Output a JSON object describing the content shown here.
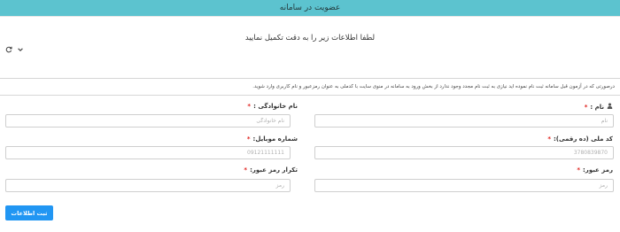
{
  "header": {
    "title": "عضویت در سامانه"
  },
  "instructions": "لطفا اطلاعات زیر را به دقت تکمیل نمایید",
  "toolbar": {
    "refresh_icon": "refresh-icon",
    "collapse_icon": "chevron-down-icon"
  },
  "notice": "درصورتی که در آزمون قبل سامانه ثبت نام نموده اید نیازی به ثبت نام مجدد وجود ندارد از بخش ورود به سامانه در منوی سایت با کدملی به عنوان رمزعبور و نام کاربری وارد شوید.",
  "form": {
    "required_mark": "*",
    "first_name": {
      "label": "نام :",
      "placeholder": "نام",
      "icon": "user-icon"
    },
    "last_name": {
      "label": "نام خانوادگی :",
      "placeholder": "نام خانوادگی"
    },
    "national_code": {
      "label": "کد ملی (ده رقمی):",
      "placeholder": "3780839870"
    },
    "mobile": {
      "label": "شماره موبایل:",
      "placeholder": "09121111111"
    },
    "password": {
      "label": "رمز عبور:",
      "placeholder": "رمز"
    },
    "password_repeat": {
      "label": "تکرار رمز عبور:",
      "placeholder": "رمز"
    },
    "submit_label": "ثبت اطلاعات"
  }
}
